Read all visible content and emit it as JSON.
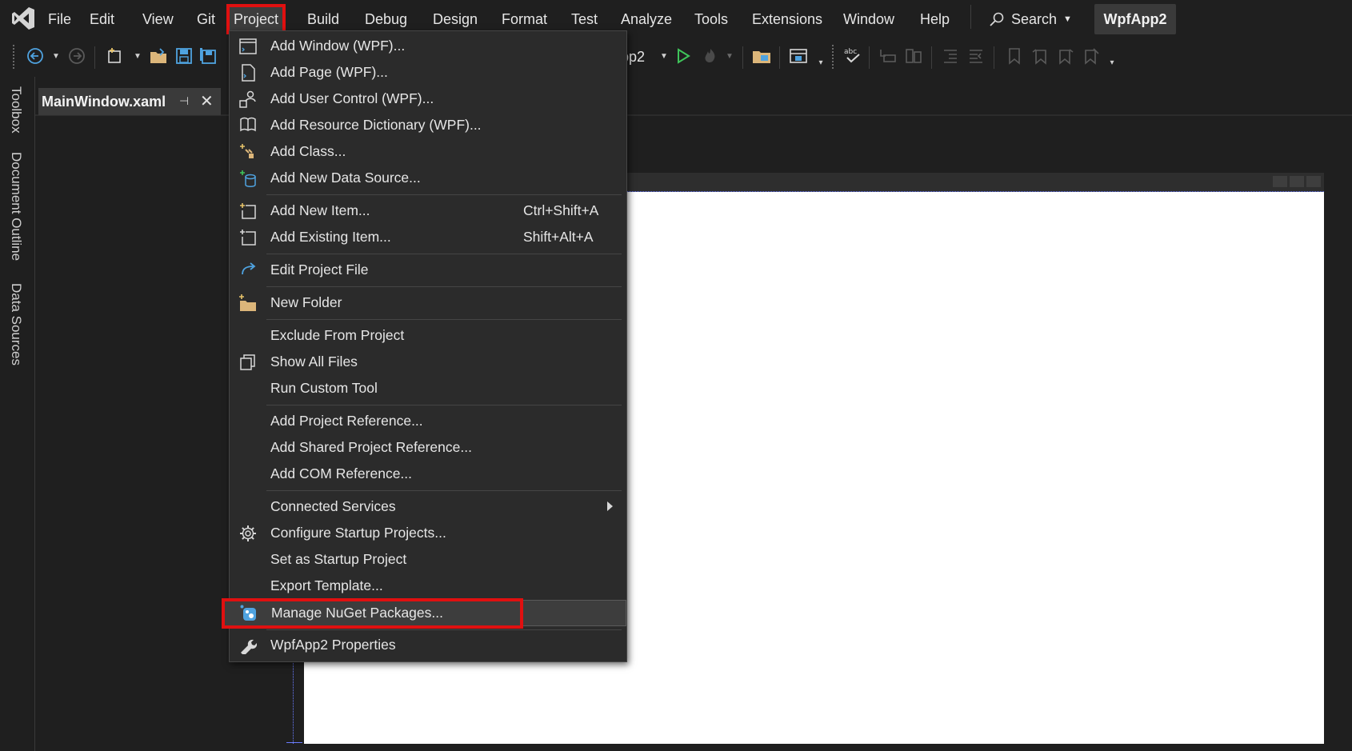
{
  "menubar": {
    "items": [
      "File",
      "Edit",
      "View",
      "Git",
      "Project",
      "Build",
      "Debug",
      "Design",
      "Format",
      "Test",
      "Analyze",
      "Tools",
      "Extensions",
      "Window",
      "Help"
    ],
    "active": "Project",
    "search_label": "Search",
    "app_title": "WpfApp2"
  },
  "toolbar": {
    "startup_project_partial": "pp2"
  },
  "sidebar": {
    "tabs": [
      "Toolbox",
      "Document Outline",
      "Data Sources"
    ]
  },
  "document_tab": {
    "name": "MainWindow.xaml"
  },
  "project_menu": {
    "items": [
      {
        "label": "Add Window (WPF)...",
        "icon": "window-icon"
      },
      {
        "label": "Add Page (WPF)...",
        "icon": "page-icon"
      },
      {
        "label": "Add User Control (WPF)...",
        "icon": "user-control-icon"
      },
      {
        "label": "Add Resource Dictionary (WPF)...",
        "icon": "resource-dictionary-icon"
      },
      {
        "label": "Add Class...",
        "icon": "class-icon"
      },
      {
        "label": "Add New Data Source...",
        "icon": "data-source-icon"
      },
      {
        "label": "Add New Item...",
        "shortcut": "Ctrl+Shift+A",
        "icon": "new-item-icon"
      },
      {
        "label": "Add Existing Item...",
        "shortcut": "Shift+Alt+A",
        "icon": "existing-item-icon"
      },
      {
        "label": "Edit Project File",
        "icon": "edit-project-icon"
      },
      {
        "label": "New Folder",
        "icon": "new-folder-icon"
      },
      {
        "label": "Exclude From Project"
      },
      {
        "label": "Show All Files",
        "icon": "show-all-files-icon"
      },
      {
        "label": "Run Custom Tool"
      },
      {
        "label": "Add Project Reference..."
      },
      {
        "label": "Add Shared Project Reference..."
      },
      {
        "label": "Add COM Reference..."
      },
      {
        "label": "Connected Services",
        "submenu": true
      },
      {
        "label": "Configure Startup Projects...",
        "icon": "gear-icon"
      },
      {
        "label": "Set as Startup Project"
      },
      {
        "label": "Export Template..."
      },
      {
        "label": "Manage NuGet Packages...",
        "icon": "nuget-icon",
        "highlighted": true
      },
      {
        "label": "WpfApp2 Properties",
        "icon": "wrench-icon"
      }
    ]
  },
  "colors": {
    "highlight_red": "#e01010",
    "accent_blue": "#4fa3e0",
    "folder_yellow": "#dcb67a",
    "play_green": "#3fc45a"
  }
}
